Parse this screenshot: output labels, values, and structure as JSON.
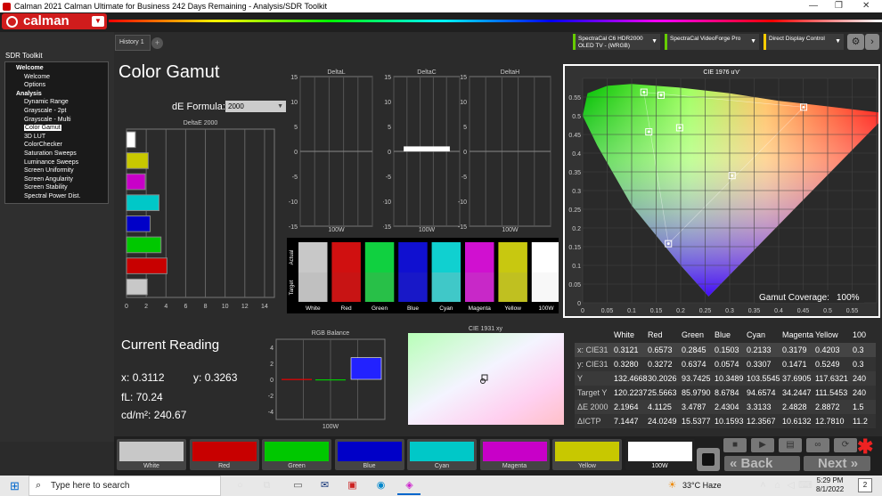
{
  "window": {
    "title": "Calman 2021 Calman Ultimate for Business 242 Days Remaining  - Analysis/SDR Toolkit"
  },
  "brand": {
    "logo": "calman",
    "accent": "#d01c1c"
  },
  "sidebar": {
    "title": "SDR Toolkit",
    "items": [
      {
        "label": "Welcome",
        "level": 1
      },
      {
        "label": "Welcome",
        "level": 2
      },
      {
        "label": "Options",
        "level": 2
      },
      {
        "label": "Analysis",
        "level": 1
      },
      {
        "label": "Dynamic Range",
        "level": 2
      },
      {
        "label": "Grayscale - 2pt",
        "level": 2
      },
      {
        "label": "Grayscale - Multi",
        "level": 2
      },
      {
        "label": "Color Gamut",
        "level": 2,
        "selected": true
      },
      {
        "label": "3D LUT",
        "level": 2
      },
      {
        "label": "ColorChecker",
        "level": 2
      },
      {
        "label": "Saturation Sweeps",
        "level": 2
      },
      {
        "label": "Luminance Sweeps",
        "level": 2
      },
      {
        "label": "Screen Uniformity",
        "level": 2
      },
      {
        "label": "Screen Angularity",
        "level": 2
      },
      {
        "label": "Screen Stability",
        "level": 2
      },
      {
        "label": "Spectral Power Dist.",
        "level": 2
      }
    ]
  },
  "tabs": {
    "history": "History 1",
    "add": "+"
  },
  "devices": {
    "meter": "SpectraCal C6 HDR2000\nOLED TV - (WRGB)",
    "pattern": "SpectraCal VideoForge Pro",
    "display": "Direct Display Control"
  },
  "page": {
    "title": "Color Gamut",
    "de_formula_label": "dE Formula:",
    "de_formula_value": "2000"
  },
  "deltae_chart": {
    "title": "DeltaE 2000",
    "ticks": [
      "0",
      "2",
      "4",
      "6",
      "8",
      "10",
      "12",
      "14"
    ],
    "colors": [
      "#ffffff",
      "#c8c800",
      "#c800c8",
      "#00c8c8",
      "#0000c8",
      "#00c800",
      "#c80000",
      "#c8c8c8"
    ],
    "values": [
      0.9,
      2.2,
      1.9,
      3.3,
      2.4,
      3.5,
      4.1,
      2.1
    ],
    "xlim": [
      0,
      15
    ]
  },
  "delta_charts": [
    {
      "title": "DeltaL",
      "xlabel": "100W",
      "ticks": [
        "15",
        "10",
        "5",
        "0",
        "-5",
        "-10",
        "-15"
      ],
      "value": 0
    },
    {
      "title": "DeltaC",
      "xlabel": "100W",
      "ticks": [
        "15",
        "10",
        "5",
        "0",
        "-5",
        "-10",
        "-15"
      ],
      "value": 1.0
    },
    {
      "title": "DeltaH",
      "xlabel": "100W",
      "ticks": [
        "15",
        "10",
        "5",
        "0",
        "-5",
        "-10",
        "-15"
      ],
      "value": 0
    }
  ],
  "swatches": {
    "side_actual": "Actual",
    "side_target": "Target",
    "items": [
      {
        "label": "White",
        "actual": "#c8c8c8",
        "target": "#c0c0c0"
      },
      {
        "label": "Red",
        "actual": "#d01010",
        "target": "#c81414"
      },
      {
        "label": "Green",
        "actual": "#10d040",
        "target": "#28c048"
      },
      {
        "label": "Blue",
        "actual": "#1010d0",
        "target": "#1818c8"
      },
      {
        "label": "Cyan",
        "actual": "#10d0d0",
        "target": "#40c8c8"
      },
      {
        "label": "Magenta",
        "actual": "#d010d0",
        "target": "#c828c8"
      },
      {
        "label": "Yellow",
        "actual": "#c8c810",
        "target": "#c0c020"
      },
      {
        "label": "100W",
        "actual": "#ffffff",
        "target": "#f8f8f8"
      }
    ]
  },
  "reading": {
    "title": "Current Reading",
    "x_label": "x:",
    "x": "0.3112",
    "y_label": "y:",
    "y": "0.3263",
    "fl_label": "fL:",
    "fl": "70.24",
    "cd_label": "cd/m²:",
    "cd": "240.67"
  },
  "rgb_balance": {
    "title": "RGB Balance",
    "xlabel": "100W",
    "ticks": [
      "4",
      "2",
      "0",
      "-2",
      "-4"
    ],
    "r": 0.05,
    "g": -0.1,
    "b": 2.7
  },
  "cie1931": {
    "title": "CIE 1931 xy"
  },
  "cie1976": {
    "title": "CIE 1976 u'v'",
    "gamut_label": "Gamut Coverage:",
    "gamut_value": "100%",
    "xticks": [
      "0",
      "0.05",
      "0.1",
      "0.15",
      "0.2",
      "0.25",
      "0.3",
      "0.35",
      "0.4",
      "0.45",
      "0.5",
      "0.55"
    ],
    "yticks": [
      "0.55",
      "0.5",
      "0.45",
      "0.4",
      "0.35",
      "0.3",
      "0.25",
      "0.2",
      "0.15",
      "0.1",
      "0.05",
      "0"
    ]
  },
  "chart_data": [
    {
      "type": "bar",
      "title": "DeltaE 2000",
      "categories": [
        "White",
        "Yellow",
        "Magenta",
        "Cyan",
        "Blue",
        "Green",
        "Red",
        "100W"
      ],
      "values": [
        0.9,
        2.2,
        1.9,
        3.3,
        2.4,
        3.5,
        4.1,
        2.1
      ],
      "xlim": [
        0,
        15
      ]
    },
    {
      "type": "scatter",
      "title": "CIE 1976 u'v'",
      "xlim": [
        0,
        0.6
      ],
      "ylim": [
        0,
        0.6
      ],
      "target_points": [
        {
          "u": 0.451,
          "v": 0.523
        },
        {
          "u": 0.125,
          "v": 0.563
        },
        {
          "u": 0.175,
          "v": 0.158
        },
        {
          "u": 0.198,
          "v": 0.468
        },
        {
          "u": 0.16,
          "v": 0.555
        },
        {
          "u": 0.305,
          "v": 0.34
        },
        {
          "u": 0.135,
          "v": 0.457
        }
      ]
    }
  ],
  "table": {
    "headers": [
      "",
      "White",
      "Red",
      "Green",
      "Blue",
      "Cyan",
      "Magenta",
      "Yellow",
      "100"
    ],
    "rows": [
      [
        "x: CIE31",
        "0.3121",
        "0.6573",
        "0.2845",
        "0.1503",
        "0.2133",
        "0.3179",
        "0.4203",
        "0.3"
      ],
      [
        "y: CIE31",
        "0.3280",
        "0.3272",
        "0.6374",
        "0.0574",
        "0.3307",
        "0.1471",
        "0.5249",
        "0.3"
      ],
      [
        "Y",
        "132.4668",
        "30.2026",
        "93.7425",
        "10.3489",
        "103.5545",
        "37.6905",
        "117.6321",
        "240"
      ],
      [
        "Target Y",
        "120.2237",
        "25.5663",
        "85.9790",
        "8.6784",
        "94.6574",
        "34.2447",
        "111.5453",
        "240"
      ],
      [
        "ΔE 2000",
        "2.1964",
        "4.1125",
        "3.4787",
        "2.4304",
        "3.3133",
        "2.4828",
        "2.8872",
        "1.5"
      ],
      [
        "ΔICTP",
        "7.1447",
        "24.0249",
        "15.5377",
        "10.1593",
        "12.3567",
        "10.6132",
        "12.7810",
        "11.2"
      ]
    ]
  },
  "patches": [
    {
      "label": "White",
      "color": "#c8c8c8"
    },
    {
      "label": "Red",
      "color": "#c80000"
    },
    {
      "label": "Green",
      "color": "#00c800"
    },
    {
      "label": "Blue",
      "color": "#0000c8"
    },
    {
      "label": "Cyan",
      "color": "#00c8c8"
    },
    {
      "label": "Magenta",
      "color": "#c800c8"
    },
    {
      "label": "Yellow",
      "color": "#c8c800"
    },
    {
      "label": "100W",
      "color": "#ffffff"
    }
  ],
  "nav": {
    "back": "Back",
    "next": "Next"
  },
  "taskbar": {
    "search_placeholder": "Type here to search",
    "weather": "33°C  Haze",
    "time": "5:29 PM",
    "date": "8/1/2022",
    "notify": "2"
  }
}
